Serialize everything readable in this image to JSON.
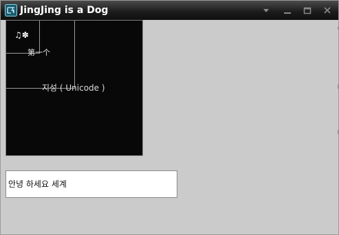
{
  "window": {
    "title": "JingJing is a Dog",
    "icon": "app-glyph-icon",
    "controls": {
      "menu_icon": "chevron-down-icon",
      "minimize_icon": "minimize-icon",
      "maximize_icon": "maximize-icon",
      "close_icon": "close-icon"
    }
  },
  "canvas": {
    "glyphs": "♫✽",
    "first_label": "第一个",
    "unicode_label": "지성 ( Unicode )"
  },
  "input": {
    "value": "안녕 하세요 세계"
  },
  "colors": {
    "titlebar": "#1a1a1a",
    "window_bg": "#cbcbcb",
    "canvas_bg": "#080808",
    "field_bg": "#ffffff"
  }
}
